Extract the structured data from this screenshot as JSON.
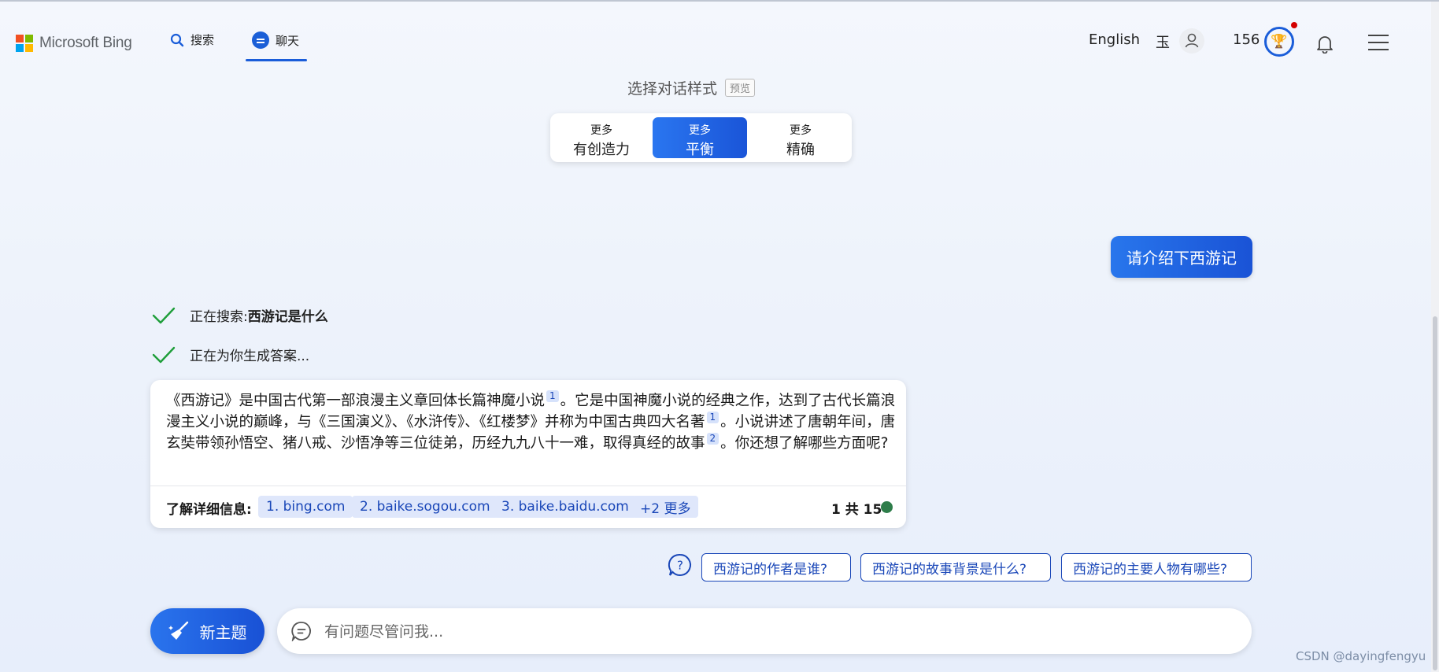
{
  "header": {
    "brand": "Microsoft Bing",
    "nav": {
      "search": "搜索",
      "chat": "聊天"
    },
    "language": "English",
    "user_name": "玉",
    "points": "156"
  },
  "style_selector": {
    "title": "选择对话样式",
    "badge": "预览",
    "options": [
      {
        "small": "更多",
        "big": "有创造力"
      },
      {
        "small": "更多",
        "big": "平衡"
      },
      {
        "small": "更多",
        "big": "精确"
      }
    ],
    "selected_index": 1
  },
  "conversation": {
    "user_message": "请介绍下西游记",
    "progress": [
      {
        "prefix": "正在搜索: ",
        "bold": "西游记是什么"
      },
      {
        "prefix": "正在为你生成答案...",
        "bold": ""
      }
    ],
    "answer": {
      "seg1": "《西游记》是中国古代第一部浪漫主义章回体长篇神魔小说",
      "cite1": "1",
      "seg2": "。它是中国神魔小说的经典之作，达到了古代长篇浪漫主义小说的巅峰，与《三国演义》、《水浒传》、《红楼梦》并称为中国古典四大名著",
      "cite2": "1",
      "seg3": "。小说讲述了唐朝年间，唐玄奘带领孙悟空、猪八戒、沙悟净等三位徒弟，历经九九八十一难，取得真经的故事",
      "cite3": "2",
      "seg4": "。你还想了解哪些方面呢?"
    },
    "learn_more": {
      "label": "了解详细信息:",
      "sources": [
        "1. bing.com",
        "2. baike.sogou.com",
        "3. baike.baidu.com"
      ],
      "more": "+2 更多",
      "count": "1 共 15"
    }
  },
  "suggestions": [
    "西游记的作者是谁?",
    "西游记的故事背景是什么?",
    "西游记的主要人物有哪些?"
  ],
  "composer": {
    "new_topic": "新主题",
    "placeholder": "有问题尽管问我..."
  },
  "watermark": "CSDN @dayingfengyu",
  "colors": {
    "accent": "#1a5dd9",
    "status_green": "#2e7d4a",
    "notification_red": "#d40000"
  }
}
